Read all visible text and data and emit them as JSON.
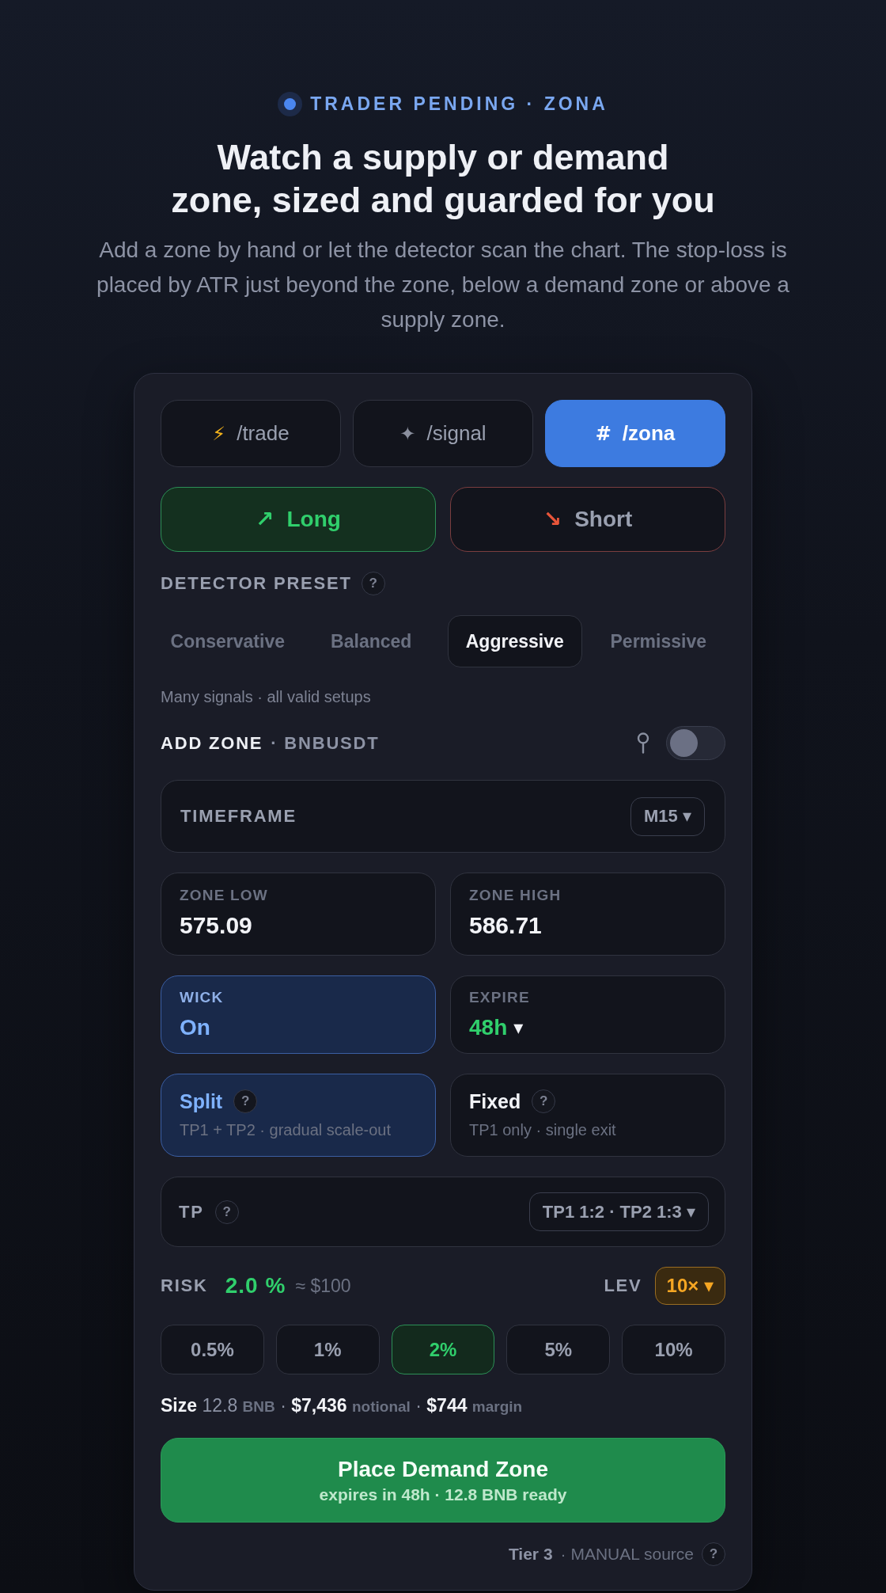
{
  "header": {
    "eyebrow": "TRADER PENDING · ZONA",
    "title_lines": [
      "Watch a supply or demand",
      "zone, sized and guarded for you"
    ],
    "description_lines": [
      "Add a zone by hand or let the detector scan the chart. The stop-loss is",
      "placed by ATR just beyond the zone, below a demand zone or above a",
      "supply zone."
    ]
  },
  "tabs": [
    {
      "icon": "⚡",
      "label": "/trade",
      "selected": false
    },
    {
      "icon": "✦",
      "label": "/signal",
      "selected": false
    },
    {
      "icon": "#",
      "label": "/zona",
      "selected": true
    }
  ],
  "sides": [
    {
      "kind": "long",
      "icon": "↗",
      "label": "Long",
      "selected": true
    },
    {
      "kind": "short",
      "icon": "↘",
      "label": "Short",
      "selected": false
    }
  ],
  "preset": {
    "label": "DETECTOR PRESET",
    "help": "?",
    "options": [
      {
        "label": "Conservative",
        "selected": false
      },
      {
        "label": "Balanced",
        "selected": false
      },
      {
        "label": "Aggressive",
        "selected": true
      },
      {
        "label": "Permissive",
        "selected": false
      }
    ],
    "description": "Many signals · all valid setups"
  },
  "add_zone": {
    "title": "ADD ZONE",
    "symbol": "· BNBUSDT",
    "detector_on": false
  },
  "timeframe": {
    "label": "TIMEFRAME",
    "value": "M15 ▾"
  },
  "zone_fields": [
    {
      "label": "ZONE LOW",
      "value": "575.09"
    },
    {
      "label": "ZONE HIGH",
      "value": "586.71"
    }
  ],
  "wick": {
    "label": "WICK",
    "value": "On",
    "on": true
  },
  "expire": {
    "label": "EXPIRE",
    "value": "48h",
    "caret": "▾"
  },
  "exit_modes": [
    {
      "title": "Split",
      "help": "?",
      "description": "TP1 + TP2 · gradual scale-out",
      "selected": true
    },
    {
      "title": "Fixed",
      "help": "?",
      "description": "TP1 only · single exit",
      "selected": false
    }
  ],
  "tp": {
    "label": "TP",
    "help": "?",
    "value": "TP1 1:2 · TP2 1:3 ▾"
  },
  "risk": {
    "label": "RISK",
    "value": "2.0 %",
    "amount": "≈ $100",
    "leverage_label": "LEV",
    "leverage": "10× ▾",
    "options": [
      {
        "label": "0.5%",
        "selected": false
      },
      {
        "label": "1%",
        "selected": false
      },
      {
        "label": "2%",
        "selected": true
      },
      {
        "label": "5%",
        "selected": false
      },
      {
        "label": "10%",
        "selected": false
      }
    ]
  },
  "size_summary": [
    {
      "kind": "key",
      "text": "Size"
    },
    {
      "kind": "number",
      "text": "12.8"
    },
    {
      "kind": "unit",
      "text": "BNB"
    },
    {
      "kind": "separator",
      "text": "·"
    },
    {
      "kind": "key",
      "text": "$7,436"
    },
    {
      "kind": "unit",
      "text": "notional"
    },
    {
      "kind": "separator",
      "text": "·"
    },
    {
      "kind": "key",
      "text": "$744"
    },
    {
      "kind": "unit",
      "text": "margin"
    }
  ],
  "place_button": {
    "title": "Place Demand Zone",
    "subtitle": "expires in 48h · 12.8 BNB ready"
  },
  "footer": {
    "tier": "Tier 3",
    "source": "· MANUAL source",
    "help": "?"
  }
}
